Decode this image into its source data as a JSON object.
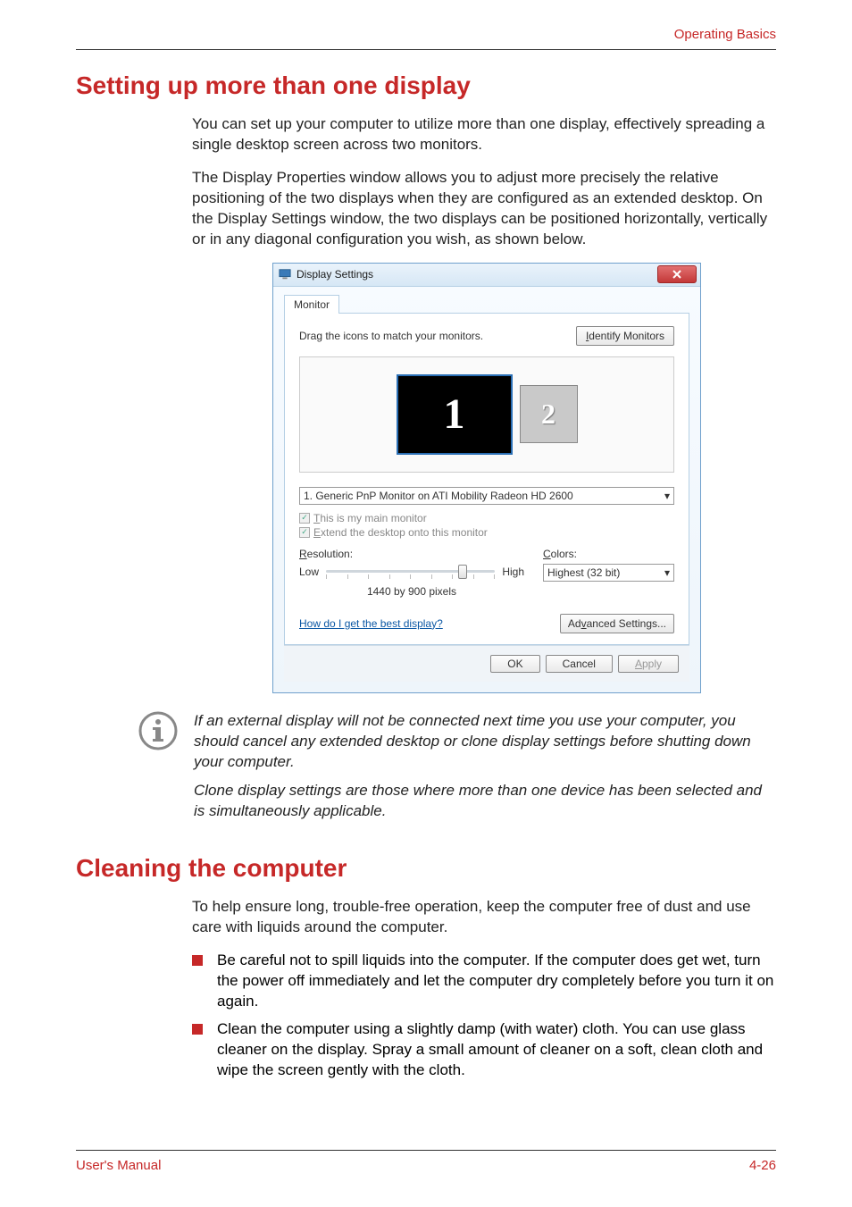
{
  "header": {
    "section": "Operating Basics"
  },
  "h1_display": "Setting up more than one display",
  "p1": "You can set up your computer to utilize more than one display, effectively spreading a single desktop screen across two monitors.",
  "p2": "The Display Properties window allows you to adjust more precisely the relative positioning of the two displays when they are configured as an extended desktop. On the Display Settings window, the two displays can be positioned horizontally, vertically or in any diagonal configuration you wish, as shown below.",
  "dialog": {
    "title": "Display Settings",
    "tab": "Monitor",
    "instruction": "Drag the icons to match your monitors.",
    "identify_btn": "Identify Monitors",
    "monitor1": "1",
    "monitor2": "2",
    "monitor_select": "1. Generic PnP Monitor on ATI Mobility Radeon HD 2600",
    "cb_main": "This is my main monitor",
    "cb_extend": "Extend the desktop onto this monitor",
    "resolution_label": "Resolution:",
    "low": "Low",
    "high": "High",
    "resolution_value": "1440 by 900 pixels",
    "colors_label": "Colors:",
    "colors_value": "Highest (32 bit)",
    "help_link": "How do I get the best display?",
    "advanced_btn": "Advanced Settings...",
    "ok": "OK",
    "cancel": "Cancel",
    "apply": "Apply"
  },
  "note": {
    "p1": "If an external display will not be connected next time you use your computer, you should cancel any extended desktop or clone display settings before shutting down your computer.",
    "p2": "Clone display settings are those where more than one device has been selected and is simultaneously applicable."
  },
  "h1_cleaning": "Cleaning the computer",
  "p3": "To help ensure long, trouble-free operation, keep the computer free of dust and use care with liquids around the computer.",
  "bullets": [
    "Be careful not to spill liquids into the computer. If the computer does get wet, turn the power off immediately and let the computer dry completely before you turn it on again.",
    "Clean the computer using a slightly damp (with water) cloth. You can use glass cleaner on the display. Spray a small amount of cleaner on a soft, clean cloth and wipe the screen gently with the cloth."
  ],
  "footer": {
    "left": "User's Manual",
    "right": "4-26"
  }
}
